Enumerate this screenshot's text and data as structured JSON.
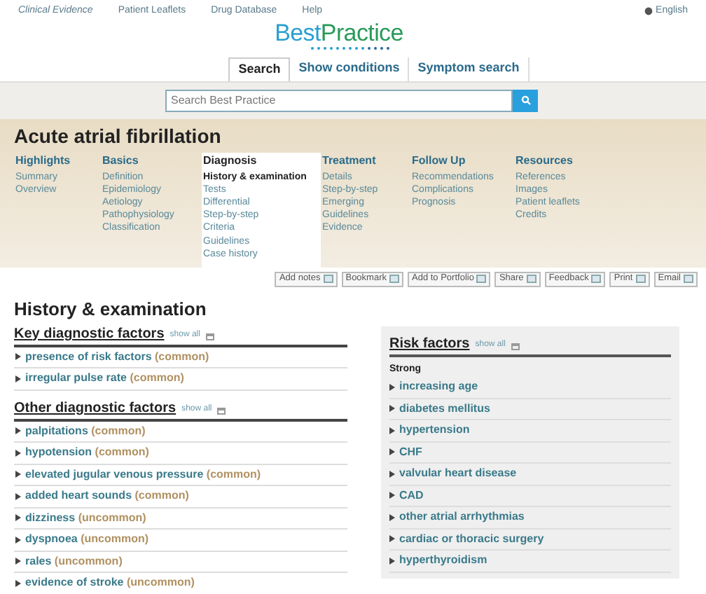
{
  "top_links": [
    "Clinical Evidence",
    "Patient Leaflets",
    "Drug Database",
    "Help"
  ],
  "language": "English",
  "logo": {
    "part_1": "Best",
    "part_2": "Practice"
  },
  "tabs": [
    {
      "label": "Search",
      "selected": true
    },
    {
      "label": "Show conditions",
      "selected": false
    },
    {
      "label": "Symptom search",
      "selected": false
    }
  ],
  "search": {
    "placeholder": "Search Best Practice"
  },
  "title": "Acute atrial fibrillation",
  "nav": [
    {
      "heading": "Highlights",
      "selected": false,
      "items": [
        {
          "label": "Summary",
          "selected": false
        },
        {
          "label": "Overview",
          "selected": false
        }
      ]
    },
    {
      "heading": "Basics",
      "selected": false,
      "items": [
        {
          "label": "Definition",
          "selected": false
        },
        {
          "label": "Epidemiology",
          "selected": false
        },
        {
          "label": "Aetiology",
          "selected": false
        },
        {
          "label": "Pathophysiology",
          "selected": false
        },
        {
          "label": "Classification",
          "selected": false
        }
      ]
    },
    {
      "heading": "Diagnosis",
      "selected": true,
      "items": [
        {
          "label": "History & examination",
          "selected": true
        },
        {
          "label": "Tests",
          "selected": false
        },
        {
          "label": "Differential",
          "selected": false
        },
        {
          "label": "Step-by-step",
          "selected": false
        },
        {
          "label": "Criteria",
          "selected": false
        },
        {
          "label": "Guidelines",
          "selected": false
        },
        {
          "label": "Case history",
          "selected": false
        }
      ]
    },
    {
      "heading": "Treatment",
      "selected": false,
      "items": [
        {
          "label": "Details",
          "selected": false
        },
        {
          "label": "Step-by-step",
          "selected": false
        },
        {
          "label": "Emerging",
          "selected": false
        },
        {
          "label": "Guidelines",
          "selected": false
        },
        {
          "label": "Evidence",
          "selected": false
        }
      ]
    },
    {
      "heading": "Follow Up",
      "selected": false,
      "items": [
        {
          "label": "Recommendations",
          "selected": false
        },
        {
          "label": "Complications",
          "selected": false
        },
        {
          "label": "Prognosis",
          "selected": false
        }
      ]
    },
    {
      "heading": "Resources",
      "selected": false,
      "items": [
        {
          "label": "References",
          "selected": false
        },
        {
          "label": "Images",
          "selected": false
        },
        {
          "label": "Patient leaflets",
          "selected": false
        },
        {
          "label": "Credits",
          "selected": false
        }
      ]
    }
  ],
  "actions": [
    "Add notes",
    "Bookmark",
    "Add to Portfolio",
    "Share",
    "Feedback",
    "Print",
    "Email"
  ],
  "section_title": "History & examination",
  "factor_groups": [
    {
      "heading": "Key diagnostic factors",
      "show_all": "show all",
      "items": [
        {
          "name": "presence of risk factors",
          "frequency": "(common)"
        },
        {
          "name": "irregular pulse rate",
          "frequency": "(common)"
        }
      ]
    },
    {
      "heading": "Other diagnostic factors",
      "show_all": "show all",
      "items": [
        {
          "name": "palpitations",
          "frequency": "(common)"
        },
        {
          "name": "hypotension",
          "frequency": "(common)"
        },
        {
          "name": "elevated jugular venous pressure",
          "frequency": "(common)"
        },
        {
          "name": "added heart sounds",
          "frequency": "(common)"
        },
        {
          "name": "dizziness",
          "frequency": "(uncommon)"
        },
        {
          "name": "dyspnoea",
          "frequency": "(uncommon)"
        },
        {
          "name": "rales",
          "frequency": "(uncommon)"
        },
        {
          "name": "evidence of stroke",
          "frequency": "(uncommon)"
        }
      ]
    }
  ],
  "risk_factors": {
    "heading": "Risk factors",
    "show_all": "show all",
    "group": "Strong",
    "items": [
      "increasing age",
      "diabetes mellitus",
      "hypertension",
      "CHF",
      "valvular heart disease",
      "CAD",
      "other atrial arrhythmias",
      "cardiac or thoracic surgery",
      "hyperthyroidism"
    ]
  }
}
